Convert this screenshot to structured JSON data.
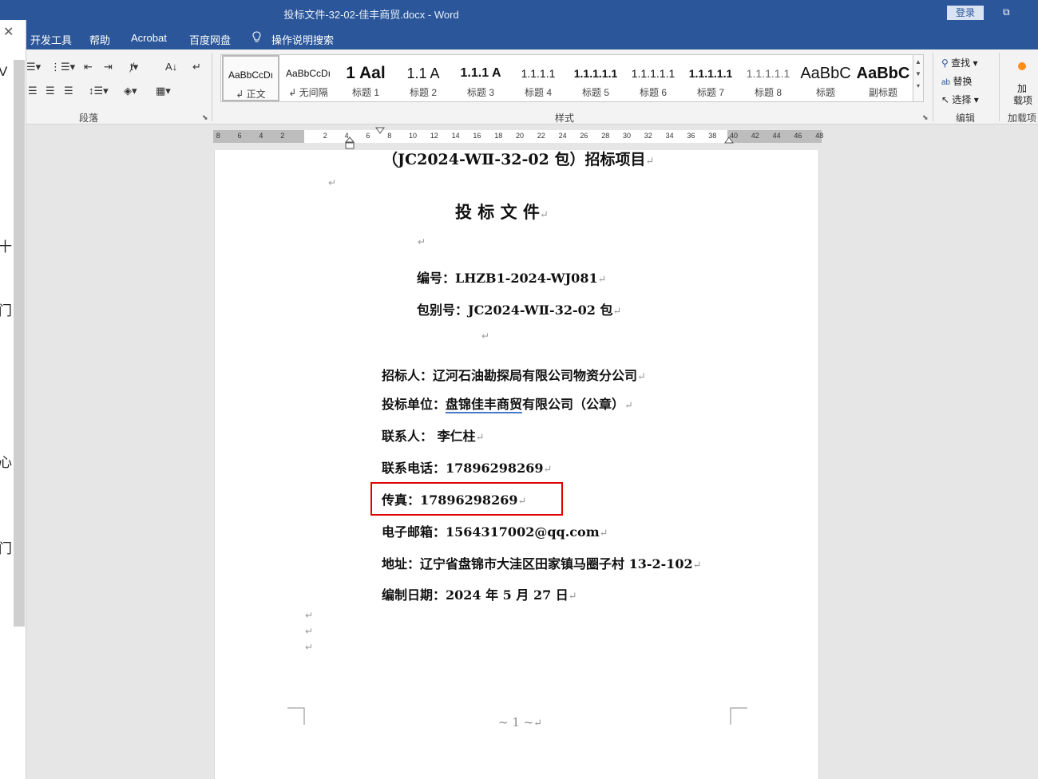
{
  "title_bar": {
    "doc_title": "投标文件-32-02-佳丰商贸.docx  -  Word",
    "login_label": "登录"
  },
  "menu": {
    "items": [
      "开发工具",
      "帮助",
      "Acrobat",
      "百度网盘",
      "操作说明搜索"
    ]
  },
  "ribbon": {
    "paragraph_group_label": "段落",
    "styles_group_label": "样式",
    "editing_group_label": "编辑",
    "addins_group_label": "加载项",
    "styles": [
      {
        "sample": "AaBbCcDı",
        "name": "↲ 正文"
      },
      {
        "sample": "AaBbCcDı",
        "name": "↲ 无间隔"
      },
      {
        "sample": "1  Aal",
        "name": "标题 1"
      },
      {
        "sample": "1.1  A",
        "name": "标题 2"
      },
      {
        "sample": "1.1.1  A",
        "name": "标题 3"
      },
      {
        "sample": "1.1.1.1",
        "name": "标题 4"
      },
      {
        "sample": "1.1.1.1.1",
        "name": "标题 5"
      },
      {
        "sample": "1.1.1.1.1",
        "name": "标题 6"
      },
      {
        "sample": "1.1.1.1.1",
        "name": "标题 7"
      },
      {
        "sample": "1.1.1.1.1",
        "name": "标题 8"
      },
      {
        "sample": "AaBbC",
        "name": "标题"
      },
      {
        "sample": "AaBbC",
        "name": "副标题"
      }
    ],
    "editing": {
      "find": "查找",
      "replace": "替换",
      "select": "选择"
    },
    "addins_button_line1": "加",
    "addins_button_line2": "载项"
  },
  "ruler": {
    "ticks": [
      "8",
      "6",
      "4",
      "2",
      "2",
      "4",
      "6",
      "8",
      "10",
      "12",
      "14",
      "16",
      "18",
      "20",
      "22",
      "24",
      "26",
      "28",
      "30",
      "32",
      "34",
      "36",
      "38",
      "40",
      "42",
      "44",
      "46",
      "48"
    ]
  },
  "document": {
    "project_line": "（JC2024-WⅡ-32-02 包）招标项目",
    "heading": "投   标   文   件",
    "number_line": "编号：LHZB1-2024-WJ081",
    "package_line": "包别号：JC2024-WⅡ-32-02 包",
    "tenderer": "招标人：辽河石油勘探局有限公司物资分公司",
    "bidder_prefix": "投标单位：",
    "bidder_name_underlined": "盘锦佳丰商贸",
    "bidder_suffix": "有限公司（公章）",
    "contact": "联系人：  李仁柱",
    "phone": "联系电话：17896298269",
    "fax": "传真：17896298269",
    "email": "电子邮箱：1564317002@qq.com",
    "address": "地址：辽宁省盘锦市大洼区田家镇马圈子村 13-2-102",
    "date": "编制日期：2024 年 5 月 27 日",
    "footer": "~ 1 ~"
  },
  "nav_pane": {
    "fragments": [
      "V",
      "十",
      "门",
      "心",
      "门"
    ]
  },
  "colors": {
    "title_bar": "#2b579a",
    "highlight_box": "#e00000"
  }
}
